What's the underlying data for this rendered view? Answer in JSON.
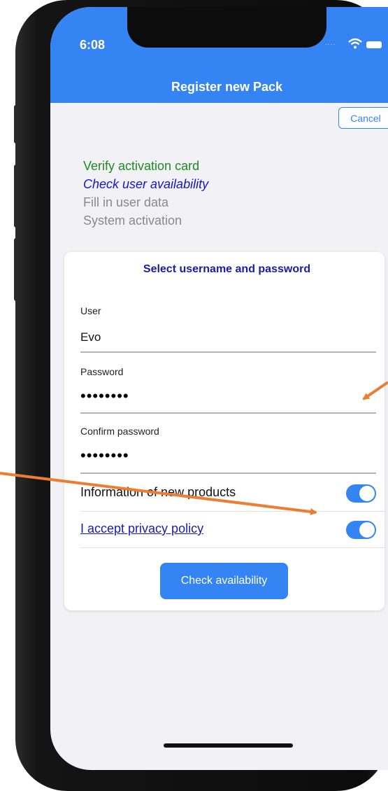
{
  "status_bar": {
    "time": "6:08",
    "signal_dots": "....",
    "icons": [
      "wifi-icon",
      "battery-icon"
    ]
  },
  "nav": {
    "title": "Register new Pack",
    "cancel_label": "Cancel"
  },
  "steps": {
    "verify": "Verify activation card",
    "check": "Check user availability",
    "fill": "Fill in user data",
    "activation": "System activation"
  },
  "form": {
    "title": "Select username and password",
    "user_label": "User",
    "user_value": "Evo",
    "password_label": "Password",
    "password_value": "••••••••",
    "confirm_label": "Confirm password",
    "confirm_value": "••••••••",
    "newsletter_label": "Information of new products",
    "newsletter_on": true,
    "privacy_label": "I accept privacy policy",
    "privacy_on": true,
    "submit_label": "Check availability"
  },
  "colors": {
    "accent": "#3584f3",
    "step_done": "#1f8a1f",
    "step_current": "#1515c8",
    "step_pending": "#8a8a8a",
    "annotation_arrow": "#ed7d31"
  }
}
